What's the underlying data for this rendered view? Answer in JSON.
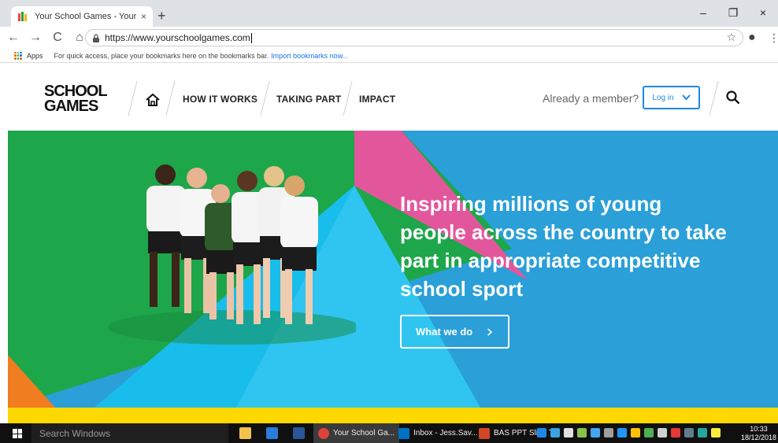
{
  "browser": {
    "tab_title": "Your School Games - Your Schoo",
    "tab_close": "×",
    "new_tab": "+",
    "url": "https://www.yourschoolgames.com",
    "minimize": "–",
    "restore": "❐",
    "close": "×",
    "back": "←",
    "forward": "→",
    "reload": "C",
    "home": "⌂",
    "star": "☆",
    "profile": "●",
    "menu": "⋮"
  },
  "bookmarks": {
    "apps_label": "Apps",
    "hint": "For quick access, place your bookmarks here on the bookmarks bar.",
    "import_link": "Import bookmarks now..."
  },
  "site_nav": {
    "links": [
      "HOW IT WORKS",
      "TAKING PART",
      "IMPACT"
    ],
    "member_prompt": "Already a member?",
    "login_label": "Log in"
  },
  "hero": {
    "headline": "Inspiring millions of young people across the country to take part in appropriate competitive school sport",
    "cta_label": "What we do"
  },
  "taskbar": {
    "search_placeholder": "Search Windows",
    "tasks": [
      "Your School Ga...",
      "Inbox - Jess.Sav...",
      "BAS PPT Slide T..."
    ],
    "time": "10:33",
    "date": "18/12/2018"
  },
  "colors": {
    "accent_blue": "#1e88e5",
    "hero_green": "#1ea64a",
    "hero_pink": "#e2579c",
    "hero_light_blue": "#19bdec",
    "hero_orange": "#f07d1f",
    "band_yellow": "#ffd800"
  }
}
